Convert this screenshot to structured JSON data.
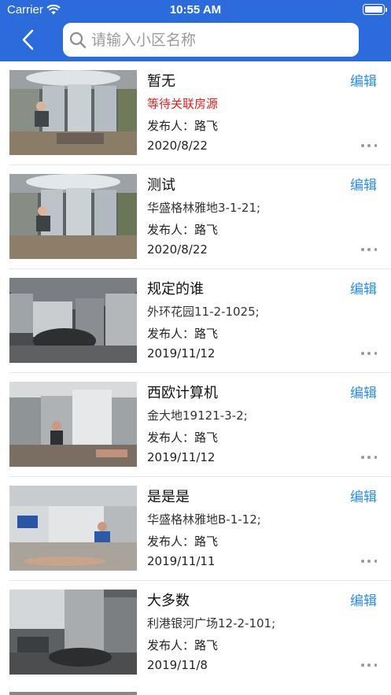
{
  "status_bar": {
    "carrier": "Carrier",
    "time": "10:55 AM"
  },
  "header": {
    "search_placeholder": "请输入小区名称"
  },
  "edit_label": "编辑",
  "items": [
    {
      "title": "暂无",
      "address": "等待关联房源",
      "address_status": "pending",
      "publisher": "发布人：路飞",
      "date": "2020/8/22",
      "thumb_theme": "office"
    },
    {
      "title": "测试",
      "address": "华盛格林雅地3-1-21;",
      "publisher": "发布人：路飞",
      "date": "2020/8/22",
      "thumb_theme": "office"
    },
    {
      "title": "规定的谁",
      "address": "外环花园11-2-1025;",
      "publisher": "发布人：路飞",
      "date": "2019/11/12",
      "thumb_theme": "metal"
    },
    {
      "title": "西欧计算机",
      "address": "金大地19121-3-2;",
      "publisher": "发布人：路飞",
      "date": "2019/11/12",
      "thumb_theme": "room"
    },
    {
      "title": "是是是",
      "address": "华盛格林雅地B-1-12;",
      "publisher": "发布人：路飞",
      "date": "2019/11/11",
      "thumb_theme": "lobby"
    },
    {
      "title": "大多数",
      "address": "利港银河广场12-2-101;",
      "publisher": "发布人：路飞",
      "date": "2019/11/8",
      "thumb_theme": "gray"
    }
  ]
}
